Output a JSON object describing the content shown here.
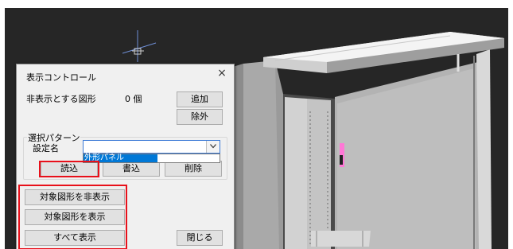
{
  "dialog": {
    "title": "表示コントロール",
    "close_glyph": "×",
    "hidden_shapes_label": "非表示とする図形",
    "hidden_shapes_count": "0 個",
    "add_button": "追加",
    "remove_button": "除外",
    "pattern_group_label": "選択パターン",
    "setting_name_label": "設定名",
    "setting_name_value": "",
    "dropdown_option": "外形パネル",
    "load_button": "読込",
    "write_button": "書込",
    "delete_button": "削除",
    "hide_target_button": "対象図形を非表示",
    "show_target_button": "対象図形を表示",
    "show_all_button": "すべて表示",
    "close_button": "閉じる"
  },
  "colors": {
    "cad_background": "#262626",
    "highlight": "#e8101a",
    "selection": "#0078d7"
  },
  "icons": {
    "ucs": "ucs-axis-icon",
    "combo_arrow": "chevron-down-icon",
    "close": "close-icon"
  }
}
